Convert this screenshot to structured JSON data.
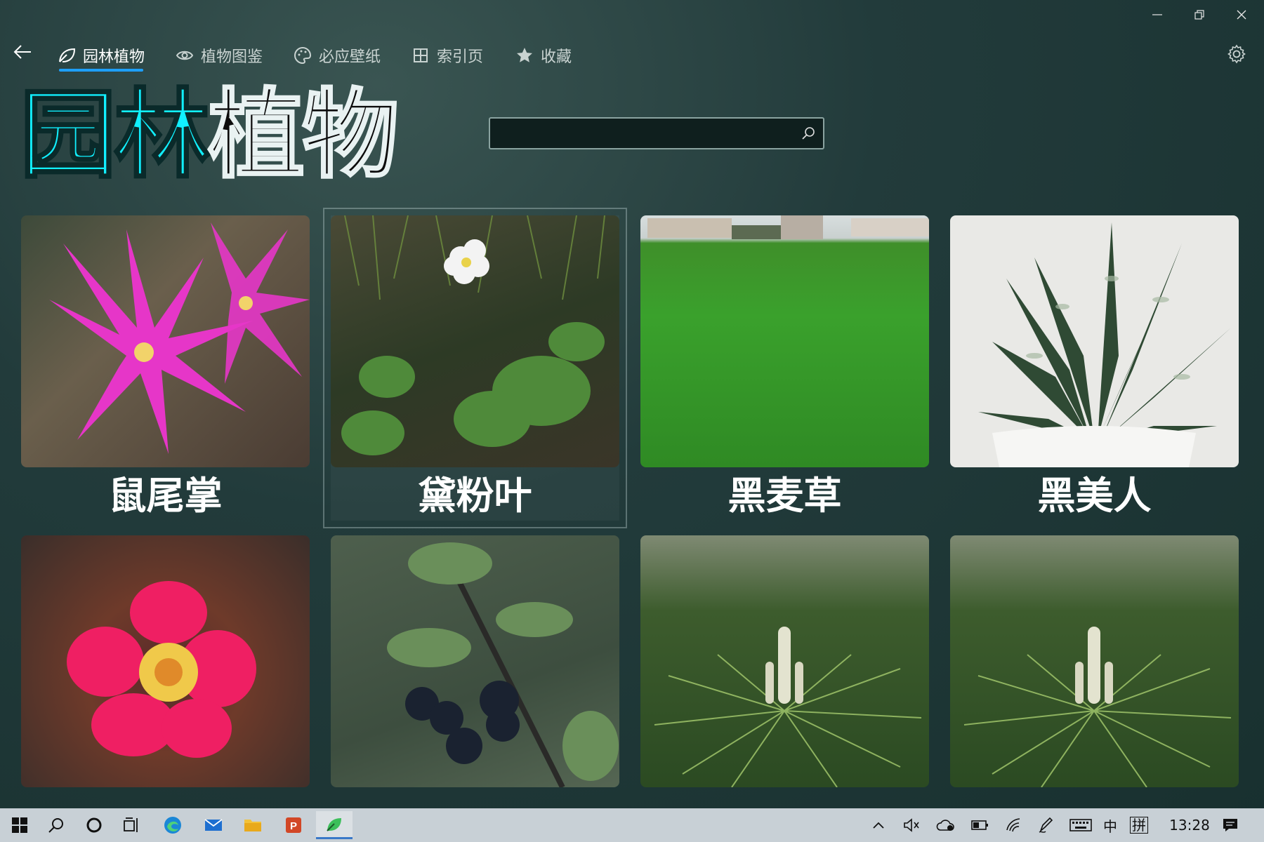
{
  "window": {
    "minimize_icon": "minimize-icon",
    "restore_icon": "restore-icon",
    "close_icon": "close-icon"
  },
  "nav": {
    "tabs": [
      {
        "label": "园林植物",
        "icon": "leaf-icon",
        "active": true
      },
      {
        "label": "植物图鉴",
        "icon": "eye-icon",
        "active": false
      },
      {
        "label": "必应壁纸",
        "icon": "palette-icon",
        "active": false
      },
      {
        "label": "索引页",
        "icon": "grid-icon",
        "active": false
      },
      {
        "label": "收藏",
        "icon": "star-icon",
        "active": false
      }
    ]
  },
  "hero": {
    "title_part1": "园林",
    "title_part2": "植物"
  },
  "search": {
    "placeholder": "",
    "value": ""
  },
  "plants": [
    {
      "name": "鼠尾掌"
    },
    {
      "name": "黛粉叶"
    },
    {
      "name": "黑麦草"
    },
    {
      "name": "黑美人"
    },
    {
      "name": ""
    },
    {
      "name": ""
    },
    {
      "name": ""
    },
    {
      "name": ""
    }
  ],
  "colors": {
    "accent": "#1ea0ff",
    "hero_cyan": "#11f0ff"
  },
  "taskbar": {
    "ime_lang": "中",
    "ime_mode": "拼",
    "time": "13:28"
  }
}
